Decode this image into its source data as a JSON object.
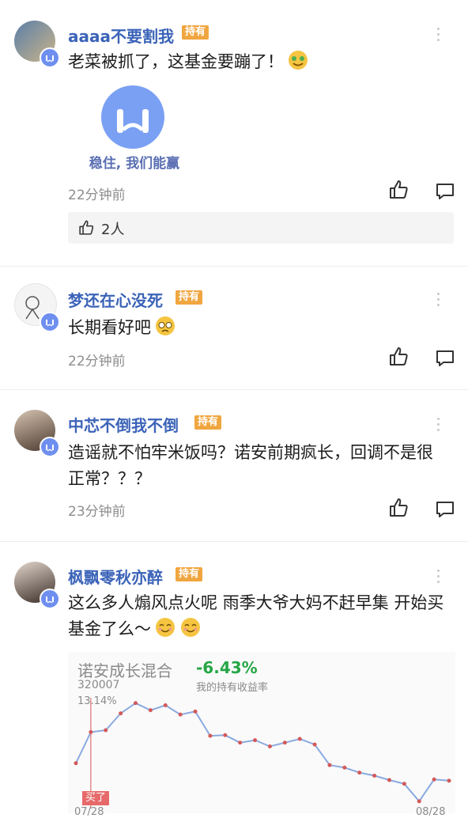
{
  "comments": [
    {
      "username": "aaaa不要割我",
      "badge": "持有",
      "text": "老菜被抓了，这基金要蹦了！",
      "sticker_caption": "稳住, 我们能赢",
      "time": "22分钟前",
      "likes_count": "2人"
    },
    {
      "username": "梦还在心没死",
      "badge": "持有",
      "text": "长期看好吧",
      "time": "22分钟前"
    },
    {
      "username": "中芯不倒我不倒",
      "badge": "持有",
      "text": "造谣就不怕牢米饭吗？诺安前期疯长，回调不是很正常？？？",
      "time": "23分钟前"
    },
    {
      "username": "枫飘零秋亦醉",
      "badge": "持有",
      "text": "这么多人煽风点火呢 雨季大爷大妈不赶早集 开始买基金了么～"
    }
  ],
  "fund_card": {
    "fund_name": "诺安成长混合",
    "fund_code": "320007",
    "return_value": "-6.43%",
    "return_label": "我的持有收益率",
    "y_top_label": "13.14%",
    "buy_label": "买了",
    "date_start": "07/28",
    "date_end": "08/28",
    "colors": {
      "line": "#8aaae0",
      "marker": "#d45858",
      "positive": "#25a645"
    }
  },
  "chart_data": {
    "type": "line",
    "x": [
      "07/28",
      "",
      "",
      "",
      "",
      "",
      "",
      "",
      "",
      "",
      "",
      "",
      "",
      "",
      "",
      "",
      "",
      "",
      "",
      "",
      "",
      "",
      "",
      "",
      "",
      "08/28"
    ],
    "series": [
      {
        "values": [
          3.5,
          8.5,
          8.8,
          11.5,
          13.14,
          12.0,
          12.8,
          11.3,
          11.8,
          7.9,
          8.0,
          6.8,
          7.2,
          6.2,
          6.8,
          7.4,
          6.5,
          3.2,
          2.8,
          2.0,
          1.5,
          0.8,
          0.2,
          -2.6,
          0.9,
          0.7
        ]
      }
    ],
    "ylim": [
      -3,
      14
    ]
  }
}
